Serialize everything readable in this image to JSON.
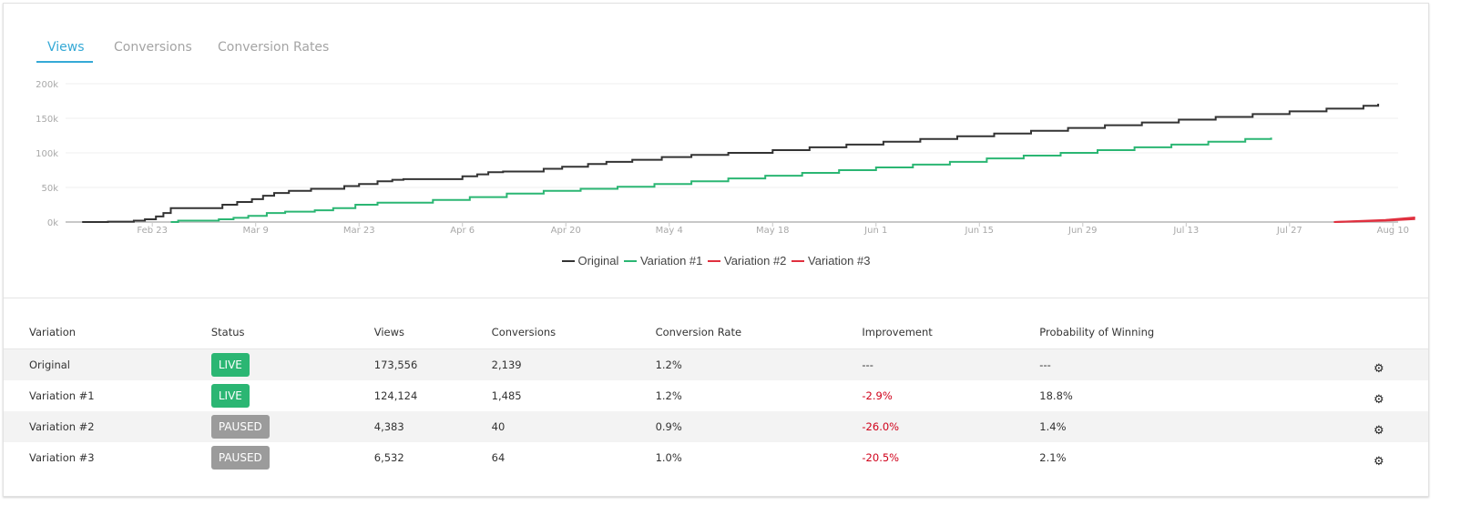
{
  "tabs": [
    {
      "label": "Views",
      "active": true
    },
    {
      "label": "Conversions",
      "active": false
    },
    {
      "label": "Conversion Rates",
      "active": false
    }
  ],
  "colors": {
    "accent": "#35a9d6",
    "original": "#333333",
    "variation1": "#2bb673",
    "variation2": "#e0303f",
    "variation3": "#e0303f",
    "live": "#2bb673",
    "paused": "#9b9b9b",
    "negative": "#d0021b"
  },
  "chart_data": {
    "type": "line",
    "title": "Views",
    "xlabel": "",
    "ylabel": "",
    "ylim": [
      0,
      200000
    ],
    "yticks": [
      0,
      50000,
      100000,
      150000,
      200000
    ],
    "ytick_labels": [
      "0k",
      "50k",
      "100k",
      "150k",
      "200k"
    ],
    "x_range_days": [
      0,
      185
    ],
    "xtick_days": [
      11,
      25,
      39,
      53,
      67,
      81,
      95,
      109,
      123,
      137,
      151,
      165,
      179
    ],
    "xtick_labels": [
      "Feb 23",
      "Mar 9",
      "Mar 23",
      "Apr 6",
      "Apr 20",
      "May 4",
      "May 18",
      "Jun 1",
      "Jun 15",
      "Jun 29",
      "Jul 13",
      "Jul 27",
      "Aug 10"
    ],
    "x_unit": "days since Feb 12",
    "grid": true,
    "legend": "bottom-center",
    "series": [
      {
        "name": "Original",
        "color": "#333333",
        "step": true,
        "points": [
          [
            3,
            0
          ],
          [
            10,
            500
          ],
          [
            17,
            2000
          ],
          [
            20,
            4000
          ],
          [
            23,
            8000
          ],
          [
            25,
            13000
          ],
          [
            27,
            20000
          ],
          [
            41,
            25000
          ],
          [
            45,
            29000
          ],
          [
            49,
            33000
          ],
          [
            52,
            38000
          ],
          [
            55,
            42000
          ],
          [
            59,
            45000
          ],
          [
            65,
            48000
          ],
          [
            74,
            52000
          ],
          [
            78,
            55000
          ],
          [
            83,
            59000
          ],
          [
            87,
            61000
          ],
          [
            90,
            62000
          ],
          [
            106,
            66000
          ],
          [
            110,
            69000
          ],
          [
            113,
            72000
          ],
          [
            117,
            73000
          ],
          [
            128,
            77000
          ],
          [
            133,
            80000
          ],
          [
            140,
            84000
          ],
          [
            145,
            87000
          ],
          [
            152,
            90000
          ],
          [
            160,
            94000
          ],
          [
            168,
            97000
          ],
          [
            178,
            100000
          ],
          [
            190,
            104000
          ],
          [
            200,
            108000
          ],
          [
            210,
            112000
          ],
          [
            220,
            116000
          ],
          [
            230,
            120000
          ],
          [
            240,
            124000
          ],
          [
            250,
            128000
          ],
          [
            260,
            132000
          ],
          [
            270,
            136000
          ],
          [
            280,
            140000
          ],
          [
            290,
            144000
          ],
          [
            300,
            148000
          ],
          [
            310,
            152000
          ],
          [
            320,
            156000
          ],
          [
            330,
            160000
          ],
          [
            340,
            164000
          ],
          [
            350,
            168000
          ],
          [
            354,
            171000
          ]
        ]
      },
      {
        "name": "Variation #1",
        "color": "#2bb673",
        "step": true,
        "points": [
          [
            27,
            0
          ],
          [
            29,
            2000
          ],
          [
            40,
            4000
          ],
          [
            44,
            6000
          ],
          [
            48,
            9000
          ],
          [
            53,
            13000
          ],
          [
            58,
            15000
          ],
          [
            66,
            17000
          ],
          [
            71,
            20000
          ],
          [
            77,
            25000
          ],
          [
            83,
            28000
          ],
          [
            90,
            28000
          ],
          [
            98,
            32000
          ],
          [
            108,
            36000
          ],
          [
            118,
            41000
          ],
          [
            128,
            45000
          ],
          [
            138,
            48000
          ],
          [
            148,
            51000
          ],
          [
            158,
            55000
          ],
          [
            168,
            59000
          ],
          [
            178,
            63000
          ],
          [
            188,
            67000
          ],
          [
            198,
            71000
          ],
          [
            208,
            75000
          ],
          [
            218,
            79000
          ],
          [
            228,
            83000
          ],
          [
            238,
            87000
          ],
          [
            248,
            92000
          ],
          [
            258,
            96000
          ],
          [
            268,
            100000
          ],
          [
            278,
            104000
          ],
          [
            288,
            108000
          ],
          [
            298,
            112000
          ],
          [
            308,
            116000
          ],
          [
            318,
            120000
          ],
          [
            325,
            122000
          ]
        ]
      },
      {
        "name": "Variation #2",
        "color": "#e0303f",
        "step": false,
        "points": [
          [
            171,
            0
          ],
          [
            178,
            2000
          ],
          [
            182,
            4383
          ]
        ]
      },
      {
        "name": "Variation #3",
        "color": "#e0303f",
        "step": false,
        "points": [
          [
            171,
            0
          ],
          [
            178,
            3000
          ],
          [
            182,
            6532
          ]
        ]
      }
    ]
  },
  "legend": [
    {
      "label": "Original",
      "color": "#333333"
    },
    {
      "label": "Variation #1",
      "color": "#2bb673"
    },
    {
      "label": "Variation #2",
      "color": "#e0303f"
    },
    {
      "label": "Variation #3",
      "color": "#e0303f"
    }
  ],
  "table": {
    "headers": [
      "Variation",
      "Status",
      "Views",
      "Conversions",
      "Conversion Rate",
      "Improvement",
      "Probability of Winning",
      ""
    ],
    "rows": [
      {
        "variation": "Original",
        "status": "LIVE",
        "status_color": "#2bb673",
        "views": "173,556",
        "conversions": "2,139",
        "rate": "1.2%",
        "improvement": "---",
        "probability": "---",
        "negative": false
      },
      {
        "variation": "Variation #1",
        "status": "LIVE",
        "status_color": "#2bb673",
        "views": "124,124",
        "conversions": "1,485",
        "rate": "1.2%",
        "improvement": "-2.9%",
        "probability": "18.8%",
        "negative": true
      },
      {
        "variation": "Variation #2",
        "status": "PAUSED",
        "status_color": "#9b9b9b",
        "views": "4,383",
        "conversions": "40",
        "rate": "0.9%",
        "improvement": "-26.0%",
        "probability": "1.4%",
        "negative": true
      },
      {
        "variation": "Variation #3",
        "status": "PAUSED",
        "status_color": "#9b9b9b",
        "views": "6,532",
        "conversions": "64",
        "rate": "1.0%",
        "improvement": "-20.5%",
        "probability": "2.1%",
        "negative": true
      }
    ],
    "settings_icon": "gear-icon"
  }
}
